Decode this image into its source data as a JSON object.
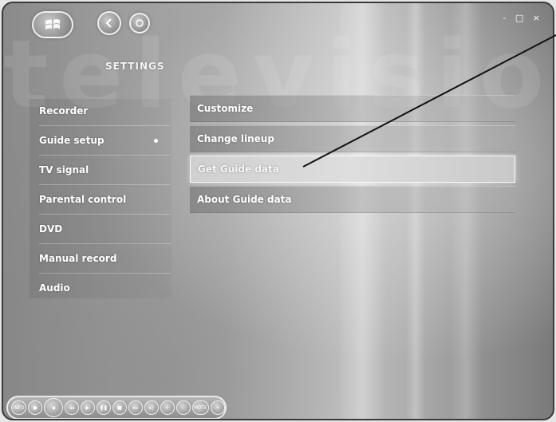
{
  "background_watermark": "television",
  "window_controls": "- □ ×",
  "header": {
    "title": "SETTINGS"
  },
  "left_menu": {
    "items": [
      {
        "label": "Recorder"
      },
      {
        "label": "Guide setup",
        "selected": true
      },
      {
        "label": "TV signal"
      },
      {
        "label": "Parental control"
      },
      {
        "label": "DVD"
      },
      {
        "label": "Manual record"
      },
      {
        "label": "Audio"
      }
    ]
  },
  "right_menu": {
    "items": [
      {
        "label": "Customize"
      },
      {
        "label": "Change lineup"
      },
      {
        "label": "Get Guide data",
        "focused": true
      },
      {
        "label": "About Guide data"
      }
    ]
  },
  "transport": {
    "buttons": [
      {
        "label": "INFO",
        "icon": "info-icon"
      },
      {
        "icon": "record-icon"
      },
      {
        "icon": "back-icon"
      },
      {
        "icon": "rewind-icon"
      },
      {
        "icon": "play-icon"
      },
      {
        "icon": "pause-icon"
      },
      {
        "icon": "stop-icon"
      },
      {
        "icon": "forward-icon"
      },
      {
        "icon": "skip-icon"
      },
      {
        "icon": "channel-plus-icon"
      },
      {
        "icon": "volume-minus-icon"
      },
      {
        "label": "MUTE",
        "icon": "mute-icon"
      },
      {
        "icon": "volume-plus-icon"
      }
    ]
  },
  "colors": {
    "text": "#ffffff",
    "focused_item": "#d8d8d8",
    "window_border": "#3a3a3a"
  }
}
